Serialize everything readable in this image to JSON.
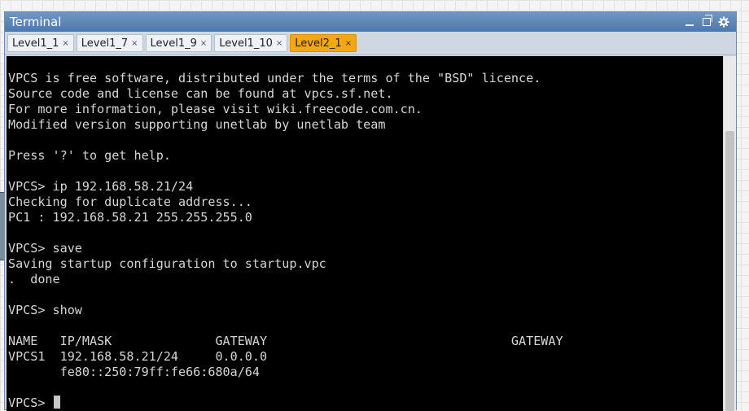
{
  "window": {
    "title": "Terminal",
    "controls": {
      "minimize_icon": "minimize-icon",
      "restore_icon": "restore-icon",
      "settings_icon": "gear-icon"
    }
  },
  "tabs": [
    {
      "label": "Level1_1",
      "close": "×",
      "active": false
    },
    {
      "label": "Level1_7",
      "close": "×",
      "active": false
    },
    {
      "label": "Level1_9",
      "close": "×",
      "active": false
    },
    {
      "label": "Level1_10",
      "close": "×",
      "active": false
    },
    {
      "label": "Level2_1",
      "close": "×",
      "active": true
    }
  ],
  "colors": {
    "active_tab": "#f3a712",
    "titlebar": "#5a84b4",
    "terminal_bg": "#000000",
    "terminal_fg": "#d6d6d6"
  },
  "terminal": {
    "lines": [
      "VPCS is free software, distributed under the terms of the \"BSD\" licence.",
      "Source code and license can be found at vpcs.sf.net.",
      "For more information, please visit wiki.freecode.com.cn.",
      "Modified version supporting unetlab by unetlab team",
      "",
      "Press '?' to get help.",
      "",
      "VPCS> ip 192.168.58.21/24",
      "Checking for duplicate address...",
      "PC1 : 192.168.58.21 255.255.255.0",
      "",
      "VPCS> save",
      "Saving startup configuration to startup.vpc",
      ".  done",
      "",
      "VPCS> show",
      "",
      "NAME   IP/MASK              GATEWAY                                 GATEWAY",
      "VPCS1  192.168.58.21/24     0.0.0.0",
      "       fe80::250:79ff:fe66:680a/64",
      ""
    ],
    "prompt": "VPCS> "
  }
}
